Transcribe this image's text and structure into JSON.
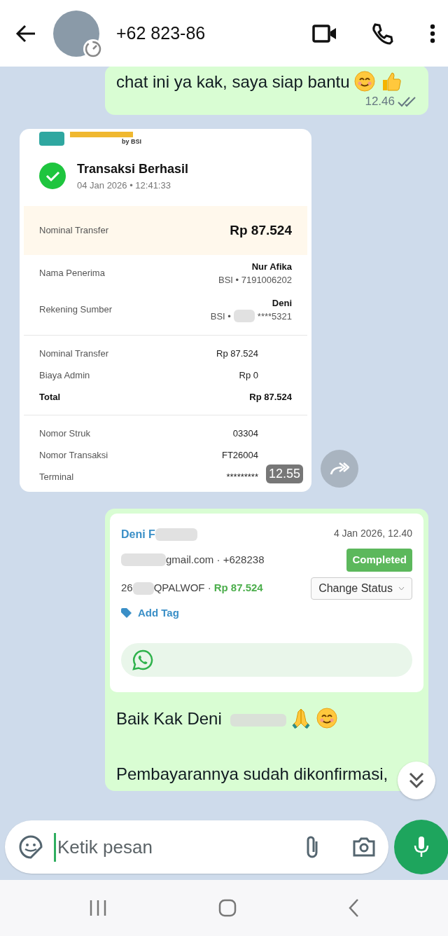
{
  "header": {
    "contact": "+62 823-86"
  },
  "messages": [
    {
      "kind": "text",
      "outgoing": true,
      "lines": [
        {
          "text": "chat ini ya kak, saya siap bantu"
        }
      ],
      "time": "12.46",
      "read": false
    },
    {
      "kind": "receipt",
      "outgoing": false,
      "logo_caption": "by BSI",
      "title": "Transaksi Berhasil",
      "datetime": "04 Jan 2026 • 12:41:33",
      "rows": [
        {
          "kind": "highlight",
          "label": "Nominal Transfer",
          "value": "Rp 87.524"
        },
        {
          "kind": "party",
          "label": "Nama Penerima",
          "value": "Nur Afika",
          "sub": "BSI • 7191006202"
        },
        {
          "kind": "party",
          "label": "Rekening Sumber",
          "value": "Deni",
          "sub": "BSI •",
          "sub2": "****5321"
        },
        {
          "kind": "divider"
        },
        {
          "kind": "plain",
          "label": "Nominal Transfer",
          "value": "Rp 87.524"
        },
        {
          "kind": "plain",
          "label": "Biaya Admin",
          "value": "Rp 0"
        },
        {
          "kind": "total",
          "label": "Total",
          "value": "Rp 87.524"
        },
        {
          "kind": "divider"
        },
        {
          "kind": "plain",
          "label": "Nomor Struk",
          "value": "03304"
        },
        {
          "kind": "plain",
          "label": "Nomor Transaksi",
          "value": "FT26004"
        },
        {
          "kind": "plain",
          "label": "Terminal",
          "value": "*********"
        }
      ],
      "time": "12.55"
    },
    {
      "kind": "order",
      "outgoing": true,
      "card": {
        "name": "Deni F",
        "date": "4 Jan 2026, 12.40",
        "contact": "gmail.com · +628238",
        "status": "Completed",
        "code_start": "26",
        "code_end": "QPALWOF ·",
        "amount": "Rp 87.524",
        "action": "Change Status",
        "tag": "Add Tag"
      },
      "lines": [
        {
          "text": "Baik Kak Deni"
        },
        {
          "text": "Pembayarannya sudah dikonfirmasi,"
        }
      ]
    }
  ],
  "composer": {
    "placeholder": "Ketik pesan"
  }
}
